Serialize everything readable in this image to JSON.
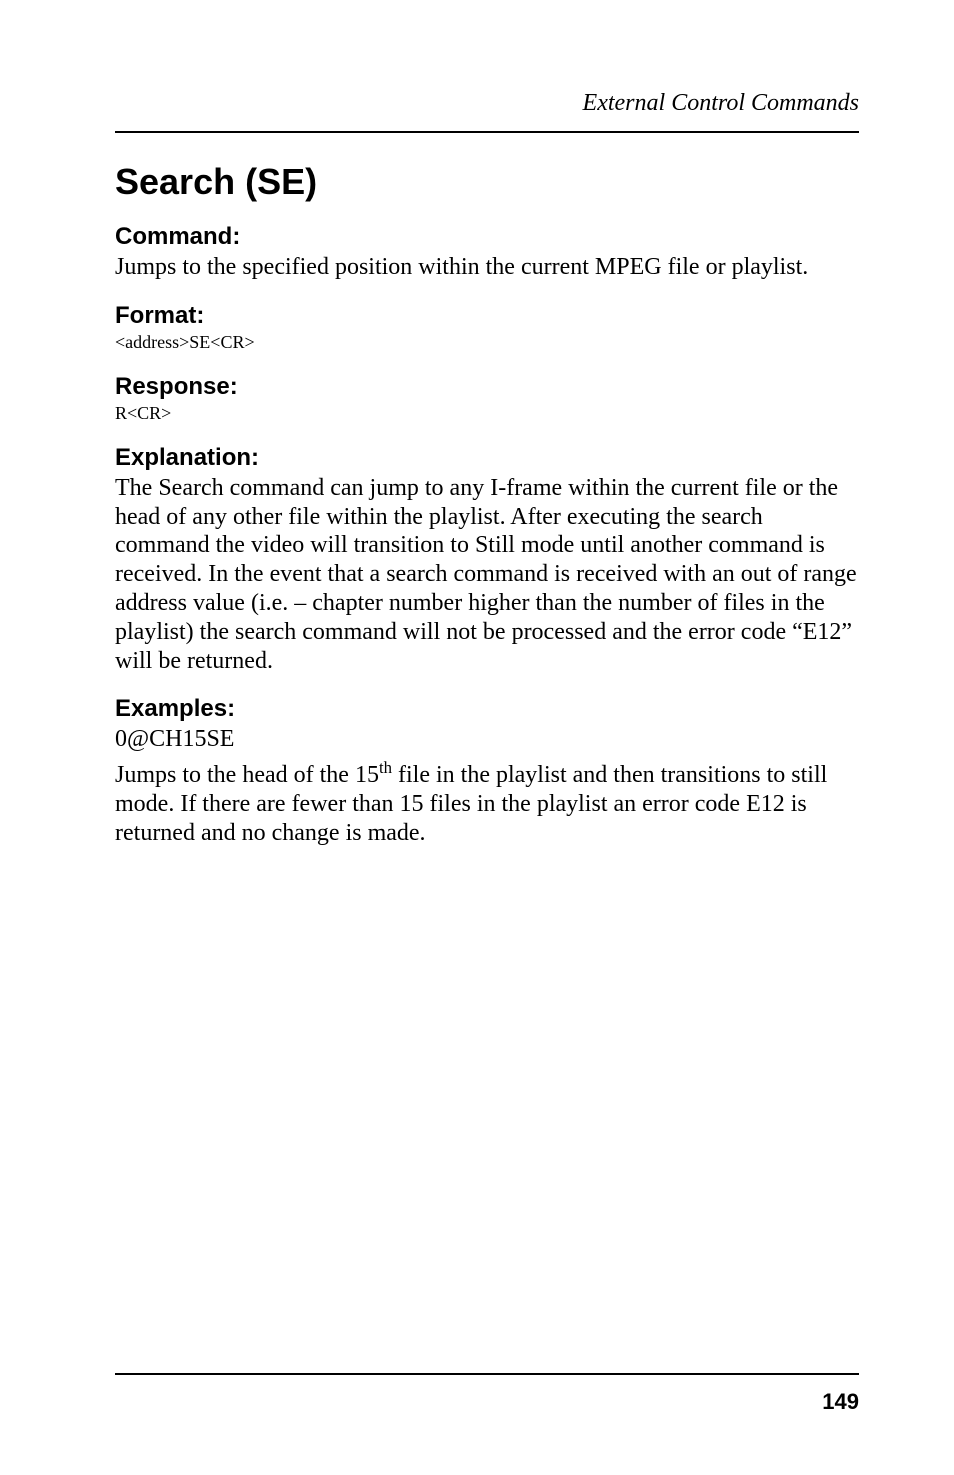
{
  "running_header": "External Control Commands",
  "title": "Search (SE)",
  "sections": {
    "command": {
      "heading": "Command:",
      "body": "Jumps to the specified position within the current MPEG file or playlist."
    },
    "format": {
      "heading": "Format:",
      "code": "<address>SE<CR>"
    },
    "response": {
      "heading": "Response:",
      "code": "R<CR>"
    },
    "explanation": {
      "heading": "Explanation:",
      "body": "The Search command can jump to any I-frame within the current file or the head of any other file within the playlist. After executing the search command the video will transition to Still mode until another command is received. In the event that a search command is received with an out of range address value (i.e. – chapter number higher than the number of files in the playlist) the search command will not be processed and the error code “E12” will be returned."
    },
    "examples": {
      "heading": "Examples:",
      "example_cmd": "0@CH15SE",
      "body_pre": "Jumps to the head of the 15",
      "body_sup": "th",
      "body_post": " file in the playlist and then transitions to still mode. If there are fewer than 15 files in the playlist an error code E12 is returned and no change is made."
    }
  },
  "page_number": "149"
}
